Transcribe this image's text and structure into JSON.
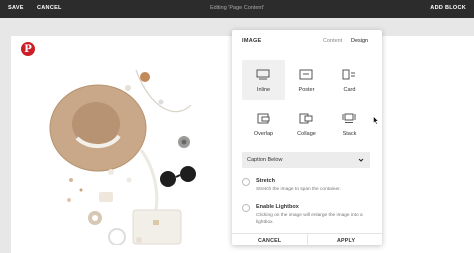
{
  "topbar": {
    "save": "SAVE",
    "cancel": "CANCEL",
    "title": "Editing 'Page Content'",
    "add_block": "ADD BLOCK"
  },
  "panel": {
    "title": "IMAGE",
    "tabs": [
      "Content",
      "Design"
    ],
    "active_tab": "Design",
    "layouts": [
      {
        "label": "Inline",
        "icon": "inline-layout-icon",
        "selected": true
      },
      {
        "label": "Poster",
        "icon": "poster-layout-icon",
        "selected": false
      },
      {
        "label": "Card",
        "icon": "card-layout-icon",
        "selected": false
      },
      {
        "label": "Overlap",
        "icon": "overlap-layout-icon",
        "selected": false
      },
      {
        "label": "Collage",
        "icon": "collage-layout-icon",
        "selected": false
      },
      {
        "label": "Stack",
        "icon": "stack-layout-icon",
        "selected": false
      }
    ],
    "caption_select": {
      "value": "Caption Below"
    },
    "options": [
      {
        "title": "Stretch",
        "description": "Stretch the image to span the container.",
        "checked": false
      },
      {
        "title": "Enable Lightbox",
        "description": "Clicking on the image will enlarge the image into a lightbox.",
        "checked": false
      }
    ],
    "footer": {
      "cancel": "CANCEL",
      "apply": "APPLY"
    }
  },
  "colors": {
    "topbar": "#2c2c2c",
    "pinterest": "#cb2027",
    "selected_option": "#f0f0f0"
  }
}
